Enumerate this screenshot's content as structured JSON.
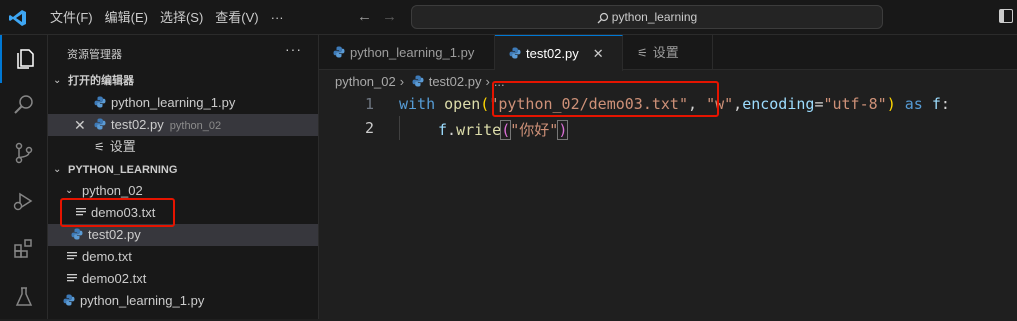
{
  "titlebar": {
    "menu": [
      "文件(F)",
      "编辑(E)",
      "选择(S)",
      "查看(V)",
      "···"
    ],
    "search_text": "python_learning"
  },
  "sidebar": {
    "title": "资源管理器",
    "more": "···",
    "open_editors_title": "打开的编辑器",
    "open_editors": [
      {
        "label": "python_learning_1.py",
        "detail": ""
      },
      {
        "label": "test02.py",
        "detail": "python_02"
      },
      {
        "label": "设置",
        "detail": ""
      }
    ],
    "workspace_title": "PYTHON_LEARNING",
    "folder": "python_02",
    "folder_files": [
      "demo03.txt",
      "test02.py"
    ],
    "root_files": [
      "demo.txt",
      "demo02.txt",
      "python_learning_1.py"
    ]
  },
  "tabs": [
    {
      "label": "python_learning_1.py"
    },
    {
      "label": "test02.py"
    },
    {
      "label": "设置"
    }
  ],
  "breadcrumb": {
    "folder": "python_02",
    "file": "test02.py",
    "more": "..."
  },
  "editor": {
    "line_numbers": [
      "1",
      "2"
    ],
    "line1": {
      "kw_with": "with",
      "fn_open": "open",
      "paren_open": "(",
      "path": "\"python_02/demo03.txt\"",
      "comma1": ", ",
      "mode": "\"w\"",
      "comma2": ",",
      "param": "encoding",
      "eq": "=",
      "enc": "\"utf-8\"",
      "paren_close": ")",
      "kw_as": "as",
      "var_f": "f",
      "colon": ":"
    },
    "line2": {
      "var_f": "f",
      "dot": ".",
      "fn_write": "write",
      "paren_open": "(",
      "text": "\"你好\"",
      "paren_close": ")"
    }
  },
  "colors": {
    "accent": "#0078d4",
    "highlight_box": "#e51400"
  }
}
